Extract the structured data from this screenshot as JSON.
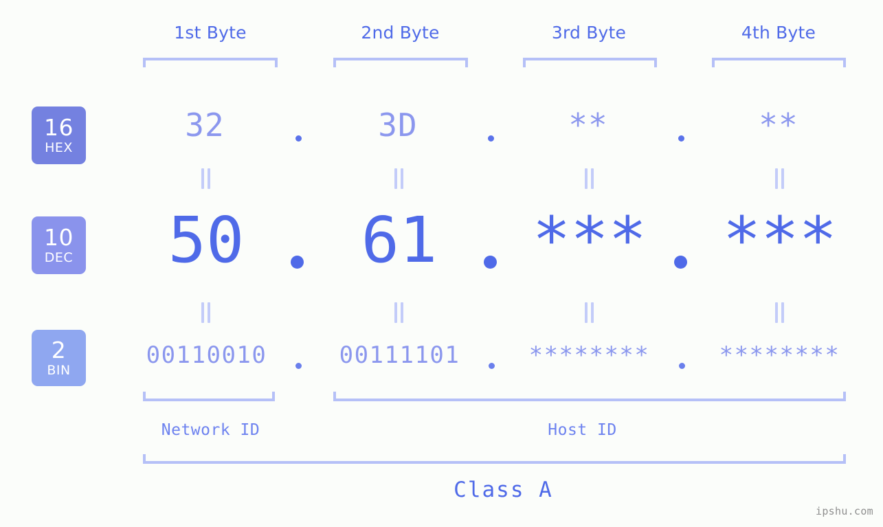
{
  "watermark": "ipshu.com",
  "columns": [
    {
      "header": "1st Byte"
    },
    {
      "header": "2nd Byte"
    },
    {
      "header": "3rd Byte"
    },
    {
      "header": "4th Byte"
    }
  ],
  "radix_badges": [
    {
      "base": "16",
      "name": "HEX",
      "color": "#7481e0"
    },
    {
      "base": "10",
      "name": "DEC",
      "color": "#8a93ec"
    },
    {
      "base": "2",
      "name": "BIN",
      "color": "#8fa7f0"
    }
  ],
  "rows": {
    "hex": {
      "values": [
        "32",
        "3D",
        "**",
        "**"
      ]
    },
    "dec": {
      "values": [
        "50",
        "61",
        "***",
        "***"
      ]
    },
    "bin": {
      "values": [
        "00110010",
        "00111101",
        "********",
        "********"
      ]
    }
  },
  "separator": ".",
  "equals_marker": "=",
  "segments": {
    "network_id": "Network ID",
    "host_id": "Host ID",
    "class": "Class A"
  },
  "colors": {
    "background": "#fbfdfa",
    "accent": "#4f6ae8",
    "accent_light": "#8b97ee",
    "bracket": "#b5c0f7",
    "watermark": "#8e8e8e"
  }
}
